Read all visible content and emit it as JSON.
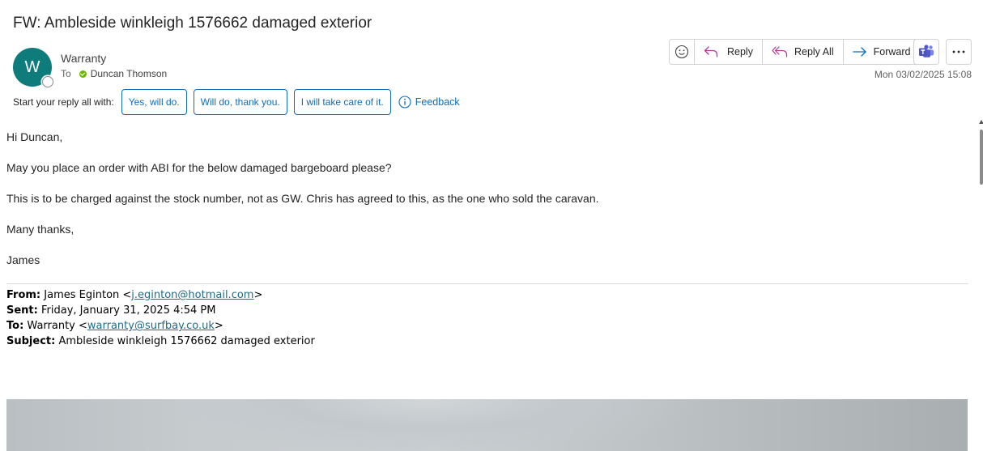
{
  "email": {
    "subject": "FW: Ambleside winkleigh 1576662 damaged exterior",
    "sender_initial": "W",
    "sender_name": "Warranty",
    "to_label": "To",
    "recipient": "Duncan Thomson",
    "date": "Mon 03/02/2025 15:08"
  },
  "actions": {
    "reply": "Reply",
    "reply_all": "Reply All",
    "forward": "Forward"
  },
  "suggestions": {
    "label": "Start your reply all with:",
    "chips": [
      "Yes, will do.",
      "Will do, thank you.",
      "I will take care of it."
    ],
    "feedback": "Feedback"
  },
  "body": {
    "greeting": "Hi Duncan,",
    "line1": "May you place an order with ABI for the below damaged bargeboard please?",
    "line2": "This is to be charged against the stock number, not as GW. Chris has agreed to this, as the one who sold the caravan.",
    "closing": "Many thanks,",
    "signature": "James"
  },
  "forwarded": {
    "from_label": "From:",
    "from_name": "James Eginton <",
    "from_email": "j.eginton@hotmail.com",
    "from_end": ">",
    "sent_label": "Sent:",
    "sent_value": "Friday, January 31, 2025 4:54 PM",
    "to_label": "To:",
    "to_name": "Warranty <",
    "to_email": "warranty@surfbay.co.uk",
    "to_end": ">",
    "subject_label": "Subject:",
    "subject_value": "Ambleside winkleigh 1576662 damaged exterior"
  },
  "colors": {
    "avatar": "#0f7c7c",
    "accent": "#0f6cbd",
    "presence_available": "#6bb700",
    "reply_icon": "#b4389b",
    "forward_icon": "#0f6cbd"
  }
}
